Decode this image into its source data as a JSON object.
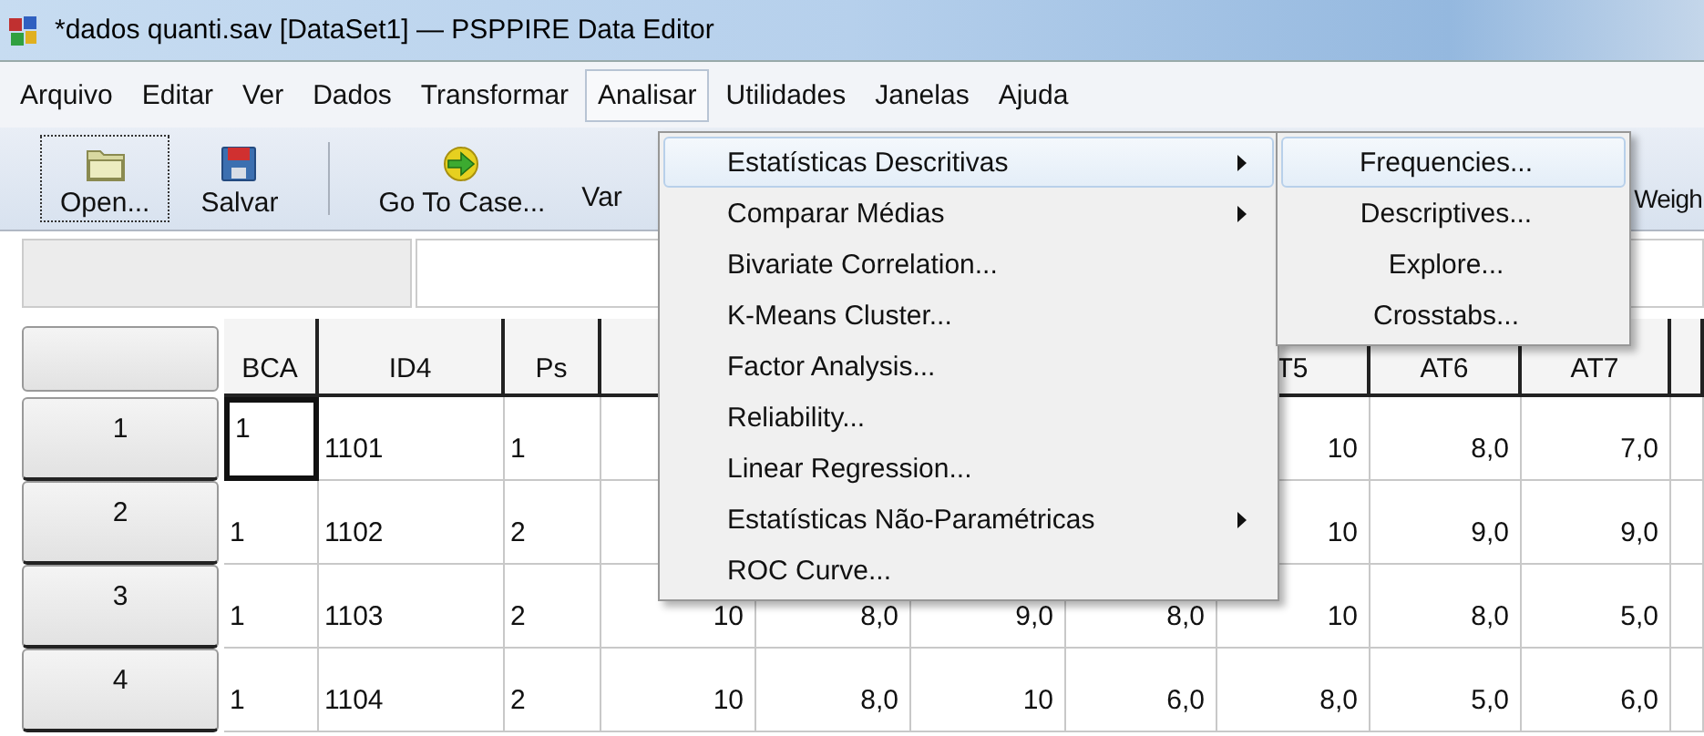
{
  "window": {
    "title": "*dados quanti.sav [DataSet1] — PSPPIRE Data Editor"
  },
  "menubar": [
    {
      "label": "Arquivo",
      "selected": false
    },
    {
      "label": "Editar",
      "selected": false
    },
    {
      "label": "Ver",
      "selected": false
    },
    {
      "label": "Dados",
      "selected": false
    },
    {
      "label": "Transformar",
      "selected": false
    },
    {
      "label": "Analisar",
      "selected": true
    },
    {
      "label": "Utilidades",
      "selected": false
    },
    {
      "label": "Janelas",
      "selected": false
    },
    {
      "label": "Ajuda",
      "selected": false
    }
  ],
  "toolbar": [
    {
      "label": "Open...",
      "kind": "open",
      "focused": true
    },
    {
      "label": "Salvar",
      "kind": "save",
      "focused": false
    },
    {
      "kind": "separator"
    },
    {
      "label": "Go To Case...",
      "kind": "goto",
      "focused": false
    },
    {
      "label": "Var",
      "kind": "plain",
      "focused": false
    },
    {
      "label": "Weigh",
      "kind": "edge",
      "focused": false
    }
  ],
  "grid": {
    "columns": [
      {
        "label": "BCA",
        "kind": "string"
      },
      {
        "label": "ID4",
        "kind": "string"
      },
      {
        "label": "Ps",
        "kind": "string"
      },
      {
        "kind": "numeric"
      },
      {
        "kind": "numeric"
      },
      {
        "kind": "numeric"
      },
      {
        "kind": "numeric"
      },
      {
        "label": "T5",
        "kind": "numeric"
      },
      {
        "label": "AT6",
        "kind": "numeric"
      },
      {
        "label": "AT7",
        "kind": "numeric"
      }
    ],
    "rows": [
      {
        "label": "1",
        "cells": [
          {
            "text": "1",
            "selected": true
          },
          {
            "text": "1101",
            "selected": false
          },
          {
            "text": "1",
            "selected": false
          },
          null,
          null,
          null,
          null,
          {
            "text": "10",
            "selected": false
          },
          {
            "text": "8,0",
            "selected": false
          },
          {
            "text": "7,0",
            "selected": false
          }
        ]
      },
      {
        "label": "2",
        "cells": [
          {
            "text": "1",
            "selected": false
          },
          {
            "text": "1102",
            "selected": false
          },
          {
            "text": "2",
            "selected": false
          },
          null,
          null,
          null,
          null,
          {
            "text": "10",
            "selected": false
          },
          {
            "text": "9,0",
            "selected": false
          },
          {
            "text": "9,0",
            "selected": false
          }
        ]
      },
      {
        "label": "3",
        "cells": [
          {
            "text": "1",
            "selected": false
          },
          {
            "text": "1103",
            "selected": false
          },
          {
            "text": "2",
            "selected": false
          },
          {
            "text": "10",
            "selected": false
          },
          {
            "text": "8,0",
            "selected": false
          },
          {
            "text": "9,0",
            "selected": false
          },
          {
            "text": "8,0",
            "selected": false
          },
          {
            "text": "10",
            "selected": false
          },
          {
            "text": "8,0",
            "selected": false
          },
          {
            "text": "5,0",
            "selected": false
          }
        ]
      },
      {
        "label": "4",
        "cells": [
          {
            "text": "1",
            "selected": false
          },
          {
            "text": "1104",
            "selected": false
          },
          {
            "text": "2",
            "selected": false
          },
          {
            "text": "10",
            "selected": false
          },
          {
            "text": "8,0",
            "selected": false
          },
          {
            "text": "10",
            "selected": false
          },
          {
            "text": "6,0",
            "selected": false
          },
          {
            "text": "8,0",
            "selected": false
          },
          {
            "text": "5,0",
            "selected": false
          },
          {
            "text": "6,0",
            "selected": false
          }
        ]
      }
    ]
  },
  "menu": {
    "items": [
      {
        "label": "Estatísticas Descritivas",
        "kind": "submenu",
        "selected": true
      },
      {
        "label": "Comparar Médias",
        "kind": "submenu",
        "selected": false
      },
      {
        "label": "Bivariate Correlation...",
        "kind": "item",
        "selected": false
      },
      {
        "label": "K-Means Cluster...",
        "kind": "item",
        "selected": false
      },
      {
        "label": "Factor Analysis...",
        "kind": "item",
        "selected": false
      },
      {
        "label": "Reliability...",
        "kind": "item",
        "selected": false
      },
      {
        "label": "Linear Regression...",
        "kind": "item",
        "selected": false
      },
      {
        "label": "Estatísticas Não-Paramétricas",
        "kind": "submenu",
        "selected": false
      },
      {
        "label": "ROC Curve...",
        "kind": "item",
        "selected": false
      }
    ]
  },
  "submenu": {
    "items": [
      {
        "label": "Frequencies...",
        "selected": true
      },
      {
        "label": "Descriptives...",
        "selected": false
      },
      {
        "label": "Explore...",
        "selected": false
      },
      {
        "label": "Crosstabs...",
        "selected": false
      }
    ]
  }
}
